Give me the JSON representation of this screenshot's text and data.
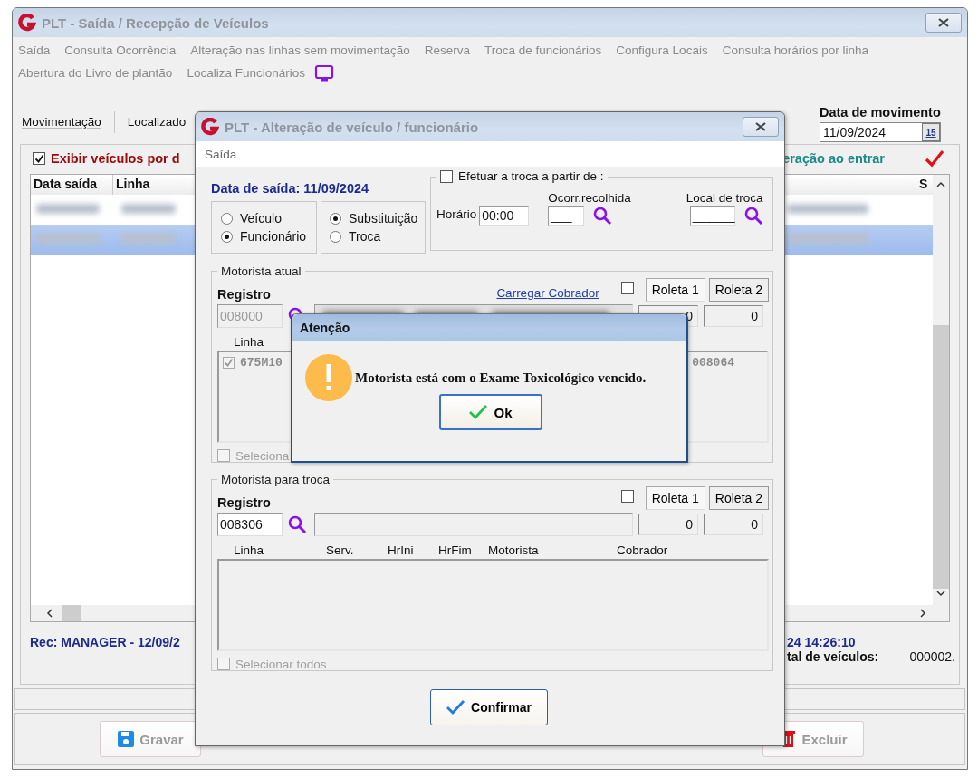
{
  "main_window": {
    "title": "PLT - Saída / Recepção de Veículos",
    "menu_rows": [
      [
        "Saída",
        "Consulta Ocorrência",
        "Alteração nas linhas sem movimentação",
        "Reserva",
        "Troca de funcionários",
        "Configura Locais",
        "Consulta horários por linha"
      ],
      [
        "Abertura do Livro de plantão",
        "Localiza Funcionários"
      ]
    ],
    "tabs": [
      {
        "label": "Movimentação",
        "selected": true
      },
      {
        "label": "Localizado",
        "selected": false
      }
    ],
    "date_label": "Data de movimento",
    "date_value": "11/09/2024",
    "calendar_day": "15",
    "show_vehicles": {
      "label": "Exibir veículos por d",
      "checked": true
    },
    "notice": "eração ao entrar",
    "grid": {
      "columns": [
        "Data saída",
        "Linha"
      ],
      "last_column": "S",
      "rows": [
        {
          "selected": false
        },
        {
          "selected": true
        }
      ]
    },
    "record_info": "Rec: MANAGER - 12/09/2",
    "record_time": "24 14:26:10",
    "total_label": "tal de veículos:",
    "total_value": "000002.",
    "buttons": [
      {
        "label": "Gravar",
        "kind": "save"
      },
      {
        "label": "Excluir",
        "kind": "delete"
      }
    ]
  },
  "dialog": {
    "title": "PLT - Alteração de veículo / funcionário",
    "menu": [
      "Saída"
    ],
    "departure": "Data de saída: 11/09/2024",
    "target": [
      {
        "label": "Veículo",
        "selected": false
      },
      {
        "label": "Funcionário",
        "selected": true
      }
    ],
    "mode": [
      {
        "label": "Substituição",
        "selected": true
      },
      {
        "label": "Troca",
        "selected": false
      }
    ],
    "swap_from": {
      "label": "Efetuar a troca a partir de :",
      "checked": false,
      "time_label": "Horário",
      "time_value": "00:00",
      "occurrence_label": "Ocorr.recolhida",
      "occurrence_value": "___",
      "place_label": "Local de troca",
      "place_value": "______"
    },
    "current_driver": {
      "legend": "Motorista atual",
      "registry_label": "Registro",
      "registry": "008000",
      "disabled": true,
      "name_redacted": true,
      "link": "Carregar Cobrador",
      "checked": false,
      "turnstiles": [
        {
          "label": "Roleta 1",
          "selected": true
        },
        {
          "label": "Roleta 2",
          "selected": false
        }
      ],
      "counts": [
        "0",
        "0"
      ],
      "columns": [
        "Linha"
      ],
      "rows": [
        {
          "checked": true,
          "line": "675M10",
          "column_2": "008064"
        }
      ],
      "select_all": {
        "label": "Seleciona",
        "checked": false
      }
    },
    "swap_driver": {
      "legend": "Motorista para troca",
      "registry_label": "Registro",
      "registry": "008306",
      "disabled": false,
      "name_redacted": false,
      "checked": false,
      "turnstiles": [
        {
          "label": "Roleta 1",
          "selected": true
        },
        {
          "label": "Roleta 2",
          "selected": false
        }
      ],
      "counts": [
        "0",
        "0"
      ],
      "columns": [
        "Linha",
        "Serv.",
        "HrIni",
        "HrFim",
        "Motorista",
        "Cobrador"
      ],
      "select_all": {
        "label": "Selecionar todos",
        "checked": false
      }
    },
    "confirm": "Confirmar"
  },
  "alert": {
    "title": "Atenção",
    "message": "Motorista está com o Exame Toxicológico vencido.",
    "button": "Ok"
  }
}
